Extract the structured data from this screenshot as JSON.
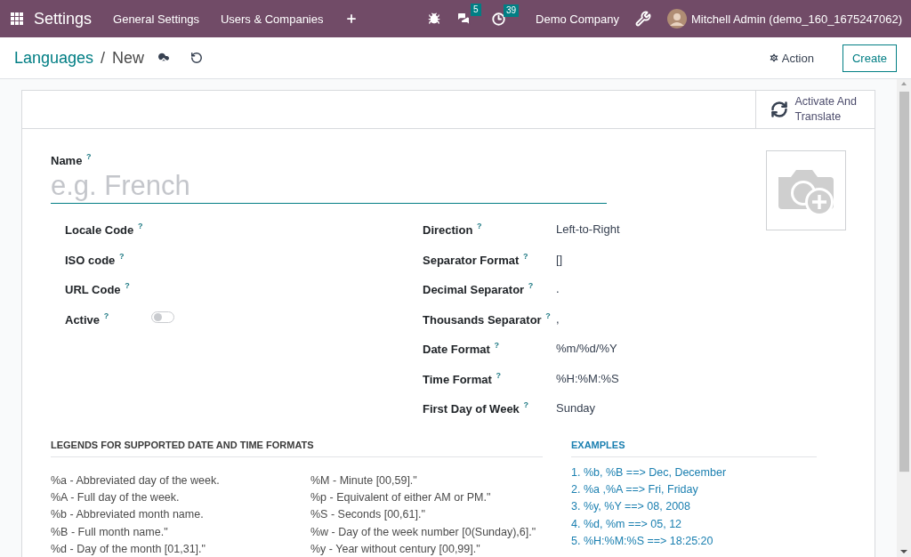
{
  "navbar": {
    "app_title": "Settings",
    "menus": [
      "General Settings",
      "Users & Companies"
    ],
    "chat_count": "5",
    "activity_count": "39",
    "company": "Demo Company",
    "user": "Mitchell Admin (demo_160_1675247062)"
  },
  "breadcrumb": {
    "parent": "Languages",
    "separator": "/",
    "current": "New"
  },
  "actions": {
    "action": "Action",
    "create": "Create"
  },
  "header_button": {
    "line1": "Activate And",
    "line2": "Translate"
  },
  "name_field": {
    "label": "Name $^{?}$",
    "placeholder": "e.g. French"
  },
  "left_fields": [
    {
      "kind": "text",
      "label": "Locale Code $^{?}$"
    },
    {
      "kind": "text",
      "label": "ISO code $^{?}$"
    },
    {
      "kind": "text",
      "label": "URL Code $^{?}$"
    },
    {
      "kind": "toggle",
      "label": "Active $^{?}$",
      "on": false
    }
  ],
  "right_fields": [
    {
      "label": "Direction $^{?}$",
      "value": "Left-to-Right"
    },
    {
      "label": "Separator Format $^{?}$",
      "value": "[]"
    },
    {
      "label": "Decimal Separator $^{?}$",
      "value": "."
    },
    {
      "label": "Thousands Separator $^{?}$",
      "value": ","
    },
    {
      "label": "Date Format $^{?}$",
      "value": "%m/%d/%Y"
    },
    {
      "label": "Time Format $^{?}$",
      "value": "%H:%M:%S"
    },
    {
      "label": "First Day of Week $^{?}$",
      "value": "Sunday"
    }
  ],
  "legends": {
    "title": "LEGENDS FOR SUPPORTED DATE AND TIME FORMATS",
    "columns": [
      [
        "%a - Abbreviated day of the week.",
        "%A - Full day of the week.",
        "%b - Abbreviated month name.",
        "%B - Full month name.\"",
        "%d - Day of the month [01,31].\""
      ],
      [
        "%M - Minute [00,59].\"",
        "%p - Equivalent of either AM or PM.\"",
        "%S - Seconds [00,61].\"",
        "%w - Day of the week number [0(Sunday),6].\"",
        "%y - Year without century [00,99].\""
      ]
    ]
  },
  "examples": {
    "title": "EXAMPLES",
    "items": [
      "1. %b, %B ==> Dec, December",
      "2. %a ,%A ==> Fri, Friday",
      "3. %y, %Y ==> 08, 2008",
      "4. %d, %m ==> 05, 12",
      "5. %H:%M:%S ==> 18:25:20"
    ]
  }
}
